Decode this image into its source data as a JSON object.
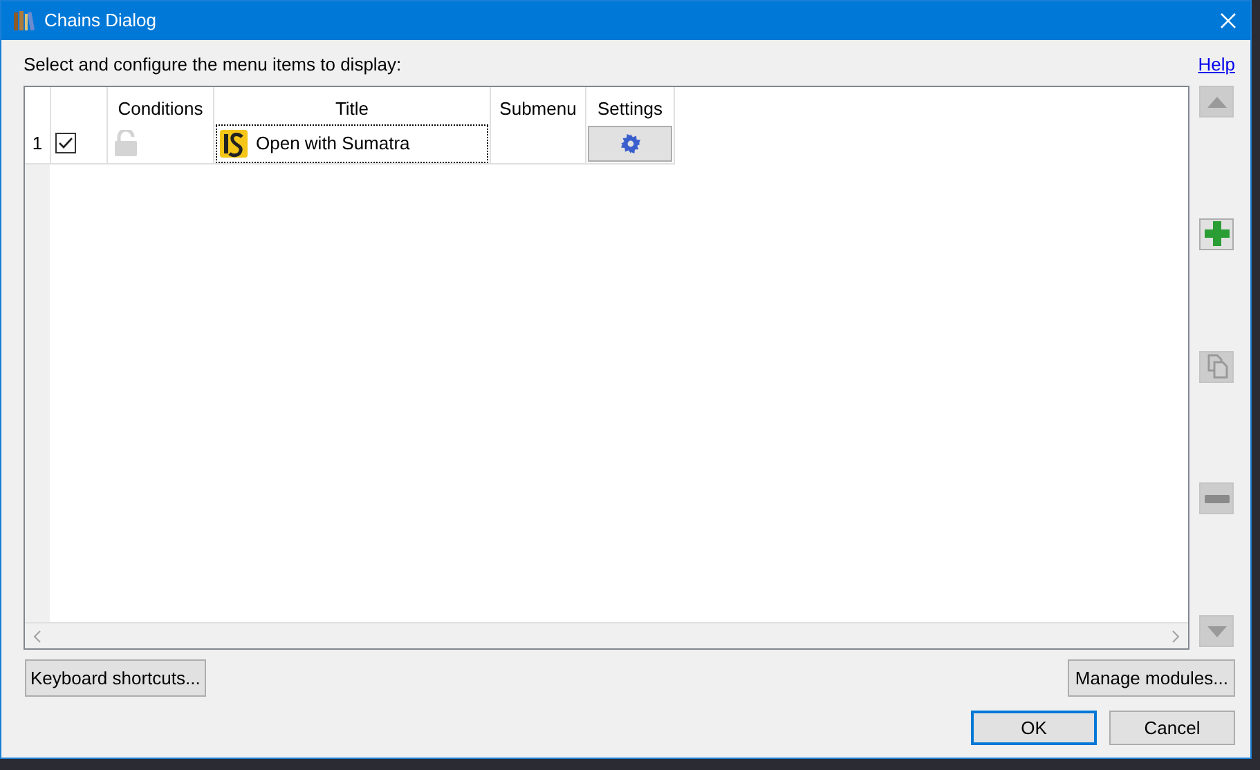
{
  "window": {
    "title": "Chains Dialog"
  },
  "instruction": "Select and configure the menu items to display:",
  "help_link": "Help",
  "table": {
    "columns": [
      "Conditions",
      "Title",
      "Submenu",
      "Settings"
    ],
    "rows": [
      {
        "number": "1",
        "checked": true,
        "title": "Open with Sumatra"
      }
    ]
  },
  "side_buttons": [
    {
      "kind": "up",
      "disabled": true
    },
    {
      "kind": "add",
      "disabled": false
    },
    {
      "kind": "copy",
      "disabled": true
    },
    {
      "kind": "remove",
      "disabled": true
    },
    {
      "kind": "down",
      "disabled": true
    }
  ],
  "left_button": "Keyboard shortcuts...",
  "right_button": "Manage modules...",
  "dialog_buttons": [
    {
      "label": "OK",
      "default": true
    },
    {
      "label": "Cancel",
      "default": false
    }
  ]
}
